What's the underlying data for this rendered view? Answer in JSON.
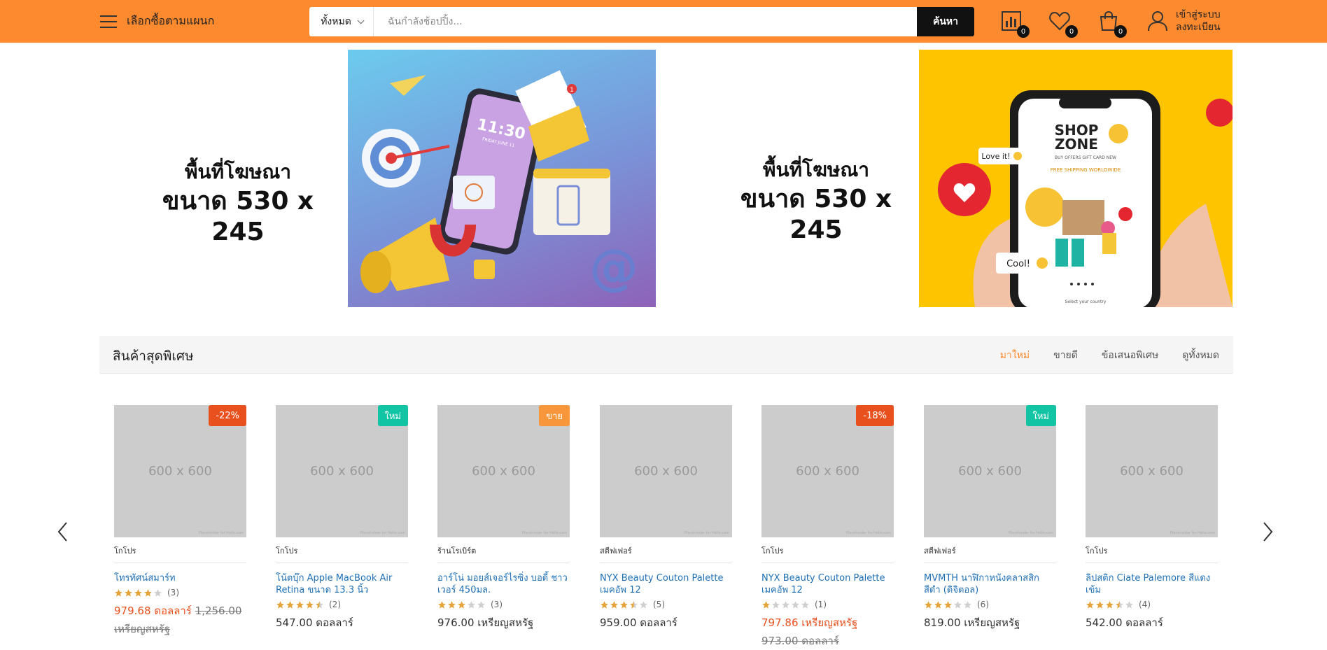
{
  "header": {
    "menu_label": "เลือกซื้อตามแผนก",
    "search": {
      "category": "ทั้งหมด",
      "placeholder": "ฉันกำลังช้อปปิ้ง...",
      "button_label": "ค้นหา"
    },
    "compare_count": "0",
    "wishlist_count": "0",
    "cart_count": "0",
    "account_line1": "เข้าสู่ระบบ",
    "account_line2": "ลงทะเบียน",
    "accent_color": "#fd8a2e"
  },
  "banners": [
    {
      "line1": "พื้นที่โฆษณา",
      "line2": "ขนาด 530 x 245",
      "phone_time": "11:30",
      "phone_date": "FRIDAY JUNE 11",
      "notification": "1"
    },
    {
      "line1": "พื้นที่โฆษณา",
      "line2": "ขนาด 530 x 245",
      "brand_line1": "SHOP",
      "brand_line2": "ZONE",
      "nav": "BUY  OFFERS  GIFT CARD  NEW",
      "shipping": "FREE SHIPPING WORLDWIDE",
      "bubble1": "Love it!",
      "bubble2": "Cool!",
      "footer": "Select your country"
    }
  ],
  "section": {
    "title": "สินค้าสุดพิเศษ",
    "tabs": [
      {
        "label": "มาใหม่",
        "active": true
      },
      {
        "label": "ขายดี",
        "active": false
      },
      {
        "label": "ข้อเสนอพิเศษ",
        "active": false
      },
      {
        "label": "ดูทั้งหมด",
        "active": false
      }
    ]
  },
  "placeholder_text": "600 x 600",
  "placeholder_note": "Placeholder for Hello.com",
  "products": [
    {
      "tag": "-22%",
      "tag_color": "#e8501e",
      "category": "โกโปร",
      "name": "โทรทัศน์สมาร์ท",
      "rating": 4,
      "reviews": "(3)",
      "price": "979.68 ดอลลาร์",
      "old_price": "1,256.00",
      "old_suffix": "เหรียญสหรัฐ",
      "on_sale": true
    },
    {
      "tag": "ใหม่",
      "tag_color": "#11c4a4",
      "category": "โกโปร",
      "name": "โน้ตบุ๊ก Apple MacBook Air Retina ขนาด 13.3 นิ้ว",
      "rating": 4.5,
      "reviews": "(2)",
      "price": "547.00 ดอลลาร์",
      "old_price": "",
      "old_suffix": "",
      "on_sale": false
    },
    {
      "tag": "ขาย",
      "tag_color": "#f7963a",
      "category": "ร้านโรเบิร์ต",
      "name": "อาร์โน่ มอยส์เจอร์ไรซิ่ง บอดี้ ชาวเวอร์ 450มล.",
      "rating": 3,
      "reviews": "(3)",
      "price": "976.00 เหรียญสหรัฐ",
      "old_price": "",
      "old_suffix": "",
      "on_sale": false
    },
    {
      "tag": "",
      "tag_color": "",
      "category": "สตีฟเฟอร์",
      "name": "NYX Beauty Couton Palette เมคอัพ 12",
      "rating": 3.5,
      "reviews": "(5)",
      "price": "959.00 ดอลลาร์",
      "old_price": "",
      "old_suffix": "",
      "on_sale": false
    },
    {
      "tag": "-18%",
      "tag_color": "#e8501e",
      "category": "โกโปร",
      "name": "NYX Beauty Couton Palette เมคอัพ 12",
      "rating": 1,
      "reviews": "(1)",
      "price": "797.86 เหรียญสหรัฐ",
      "old_price": "973.00 ดอลลาร์",
      "old_suffix": "",
      "on_sale": true
    },
    {
      "tag": "ใหม่",
      "tag_color": "#11c4a4",
      "category": "สตีฟเฟอร์",
      "name": "MVMTH นาฬิกาหนังคลาสสิก สีดำ (ดิจิตอล)",
      "rating": 3,
      "reviews": "(6)",
      "price": "819.00 เหรียญสหรัฐ",
      "old_price": "",
      "old_suffix": "",
      "on_sale": false
    },
    {
      "tag": "",
      "tag_color": "",
      "category": "โกโปร",
      "name": "ลิปสติก Ciate Palemore สีแดงเข้ม",
      "rating": 3.5,
      "reviews": "(4)",
      "price": "542.00 ดอลลาร์",
      "old_price": "",
      "old_suffix": "",
      "on_sale": false
    }
  ]
}
